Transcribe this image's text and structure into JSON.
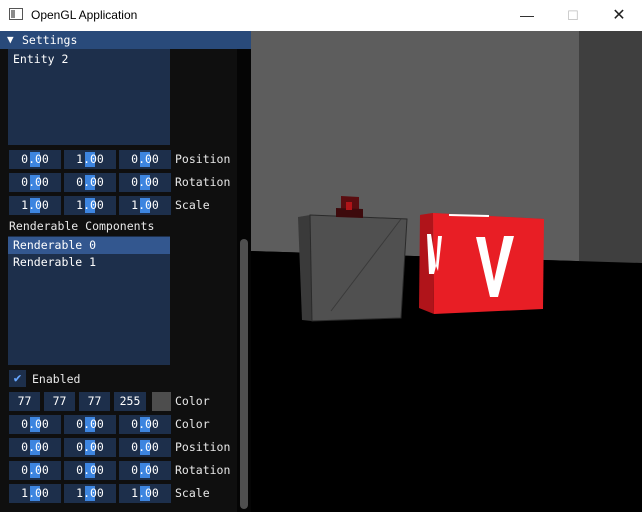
{
  "window": {
    "title": "OpenGL Application",
    "minimize": "—",
    "maximize": "☐",
    "close": "✕"
  },
  "settings": {
    "header": "Settings",
    "arrow": "▼",
    "entity_list": {
      "items": [
        "Entity 2"
      ]
    },
    "transform_rows": [
      {
        "label": "Position",
        "values": [
          "0.00",
          "1.00",
          "0.00"
        ]
      },
      {
        "label": "Rotation",
        "values": [
          "0.00",
          "0.00",
          "0.00"
        ]
      },
      {
        "label": "Scale",
        "values": [
          "1.00",
          "1.00",
          "1.00"
        ]
      }
    ],
    "renderable_components_label": "Renderable Components",
    "renderable_list": {
      "items": [
        "Renderable 0",
        "Renderable 1"
      ],
      "selected_index": 0
    },
    "enabled": {
      "label": "Enabled",
      "checked": true,
      "check_glyph": "✔"
    },
    "color_int_row": {
      "label": "Color",
      "values": [
        "77",
        "77",
        "77",
        "255"
      ],
      "swatch_color": "#4d4d4d"
    },
    "renderable_rows": [
      {
        "label": "Color",
        "values": [
          "0.00",
          "0.00",
          "0.00"
        ]
      },
      {
        "label": "Position",
        "values": [
          "0.00",
          "0.00",
          "0.00"
        ]
      },
      {
        "label": "Rotation",
        "values": [
          "0.00",
          "0.00",
          "0.00"
        ]
      },
      {
        "label": "Scale",
        "values": [
          "1.00",
          "1.00",
          "1.00"
        ]
      }
    ]
  },
  "colors": {
    "accent": "#3d85e0",
    "header": "#294a7a",
    "frame_bg": "#1d2f4b",
    "selected": "#33578f",
    "cube_red": "#e81e25",
    "cube_gray": "#505050"
  }
}
